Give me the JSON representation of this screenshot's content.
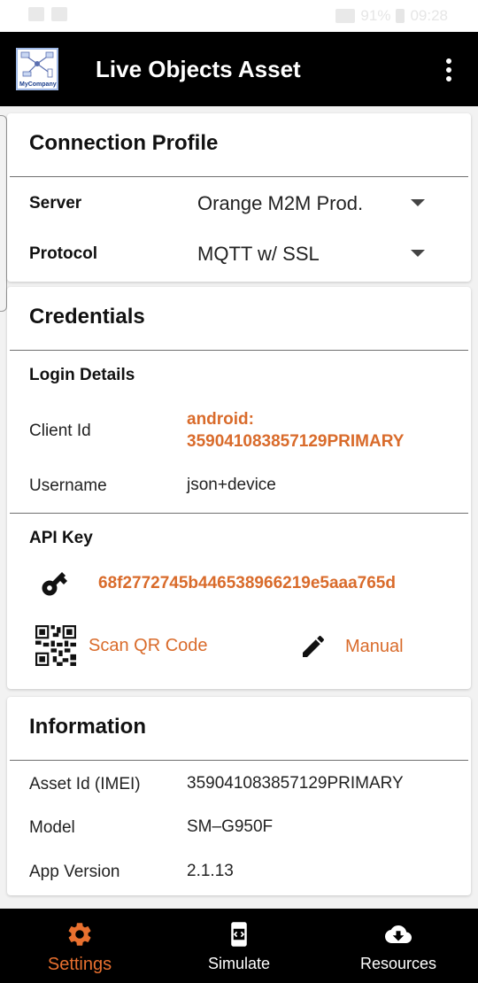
{
  "status_bar": {
    "battery": "91%",
    "time": "09:28"
  },
  "app_bar": {
    "logo_caption": "MyCompany",
    "title": "Live Objects Asset",
    "more_icon": "more-vert-icon"
  },
  "connection_profile": {
    "title": "Connection Profile",
    "server_label": "Server",
    "server_value": "Orange M2M Prod.",
    "protocol_label": "Protocol",
    "protocol_value": "MQTT w/ SSL"
  },
  "credentials": {
    "title": "Credentials",
    "login_details_label": "Login Details",
    "client_id_label": "Client Id",
    "client_id_line1": "android:",
    "client_id_line2": "359041083857129PRIMARY",
    "username_label": "Username",
    "username_value": "json+device",
    "api_key_label": "API Key",
    "api_key_value": "68f2772745b446538966219e5aaa765d",
    "scan_qr_label": "Scan QR Code",
    "manual_label": "Manual"
  },
  "information": {
    "title": "Information",
    "asset_id_label": "Asset Id (IMEI)",
    "asset_id_value": "359041083857129PRIMARY",
    "model_label": "Model",
    "model_value": "SM–G950F",
    "app_version_label": "App Version",
    "app_version_value": "2.1.13"
  },
  "bottom_nav": {
    "items": [
      {
        "label": "Settings",
        "icon": "gear-icon",
        "active": true
      },
      {
        "label": "Simulate",
        "icon": "simulate-icon",
        "active": false
      },
      {
        "label": "Resources",
        "icon": "cloud-download-icon",
        "active": false
      }
    ]
  },
  "colors": {
    "accent": "#d96b2b",
    "appbar": "#000000",
    "background": "#f2f2f2"
  }
}
